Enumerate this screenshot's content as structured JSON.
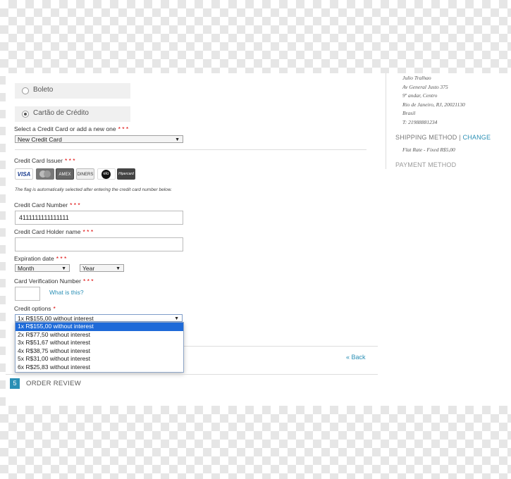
{
  "payment": {
    "boleto_label": "Boleto",
    "card_label": "Cartão de Crédito",
    "select_card_label": "Select a Credit Card or add a new one",
    "select_card_value": "New Credit Card",
    "issuer_label": "Credit Card Issuer",
    "cards": [
      "VISA",
      "MC",
      "AMEX",
      "DINERS",
      "elo",
      "Hipercard"
    ],
    "flag_note": "The flag is automatically selected after entering the credit card number below.",
    "number_label": "Credit Card Number",
    "number_value": "4111111111111111",
    "holder_label": "Credit Card Holder name",
    "holder_value": "",
    "expiry_label": "Expiration date",
    "month_value": "Month",
    "year_value": "Year",
    "cvv_label": "Card Verification Number",
    "cvv_value": "",
    "what_is_this": "What is this?",
    "credit_options_label": "Credit options",
    "credit_selected": "1x R$155,00 without interest",
    "credit_options": [
      "1x R$155,00 without interest",
      "2x R$77,50 without interest",
      "3x R$51,67 without interest",
      "4x R$38,75 without interest",
      "5x R$31,00 without interest",
      "6x R$25,83 without interest"
    ],
    "required_mark": "* * *",
    "required_mark_short": "*"
  },
  "back_link": "« Back",
  "step": {
    "number": "5",
    "label": "ORDER REVIEW"
  },
  "sidebar": {
    "address": [
      "Julio Tralhao",
      "Av General Justo 375",
      "9º andar, Centro",
      "Rio de Janeiro, RJ, 20021130",
      "Brasil",
      "T: 21988881234"
    ],
    "shipping_heading": "SHIPPING METHOD",
    "separator": "|",
    "change_link": "CHANGE",
    "shipping_rate": "Flat Rate - Fixed R$5,00",
    "payment_heading": "PAYMENT METHOD"
  },
  "colors": {
    "accent": "#2a8fb5",
    "selected_option": "#1e6ad8",
    "required": "#dd0000"
  }
}
